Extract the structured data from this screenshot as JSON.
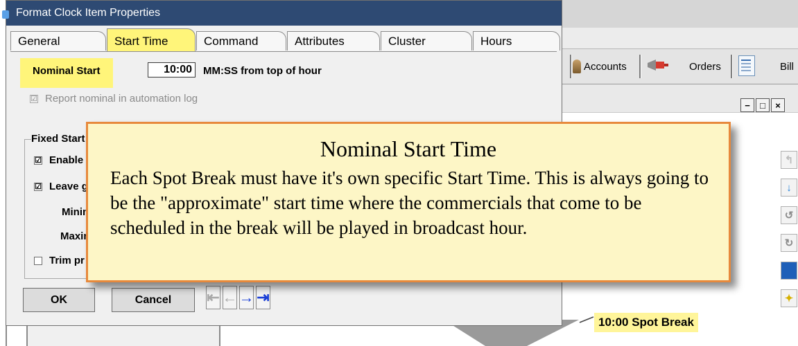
{
  "dialog": {
    "title": "Format Clock Item Properties",
    "tabs": [
      "General",
      "Start Time",
      "Command",
      "Attributes",
      "Cluster",
      "Hours"
    ],
    "active_tab": "Start Time",
    "nominal_start": {
      "label": "Nominal Start",
      "value": "10:00",
      "units": "MM:SS from top of hour"
    },
    "report_nominal": {
      "label": "Report nominal in automation log",
      "checked": "☑"
    },
    "fixed_start": {
      "legend": "Fixed Start",
      "enable_label": "Enable",
      "leave_label": "Leave g",
      "minimum_label": "Minim",
      "maximum_label": "Maxim",
      "trim_label": "Trim pr",
      "check": "☑"
    },
    "buttons": {
      "ok": "OK",
      "cancel": "Cancel"
    },
    "nav": {
      "first": "⇤",
      "prev": "←",
      "next": "→",
      "last": "⇥"
    }
  },
  "background": {
    "toolbar": {
      "accounts": "Accounts",
      "orders": "Orders",
      "billing": "Bill"
    },
    "window_buttons": {
      "minimize": "−",
      "maximize": "□",
      "close": "×"
    },
    "spot_break_label": "10:00 Spot Break"
  },
  "callout": {
    "title": "Nominal Start Time",
    "body": "Each Spot Break must have it's own specific Start Time. This is always going to be the \"approximate\" start time where the commercials that come to be scheduled in the break will be played in broadcast hour."
  },
  "colors": {
    "highlight": "#fff57a",
    "callout_fill": "#fdf6c6",
    "callout_border": "#e7893c",
    "titlebar": "#2e4a73",
    "nav_arrow_active": "#1a3fd6"
  }
}
